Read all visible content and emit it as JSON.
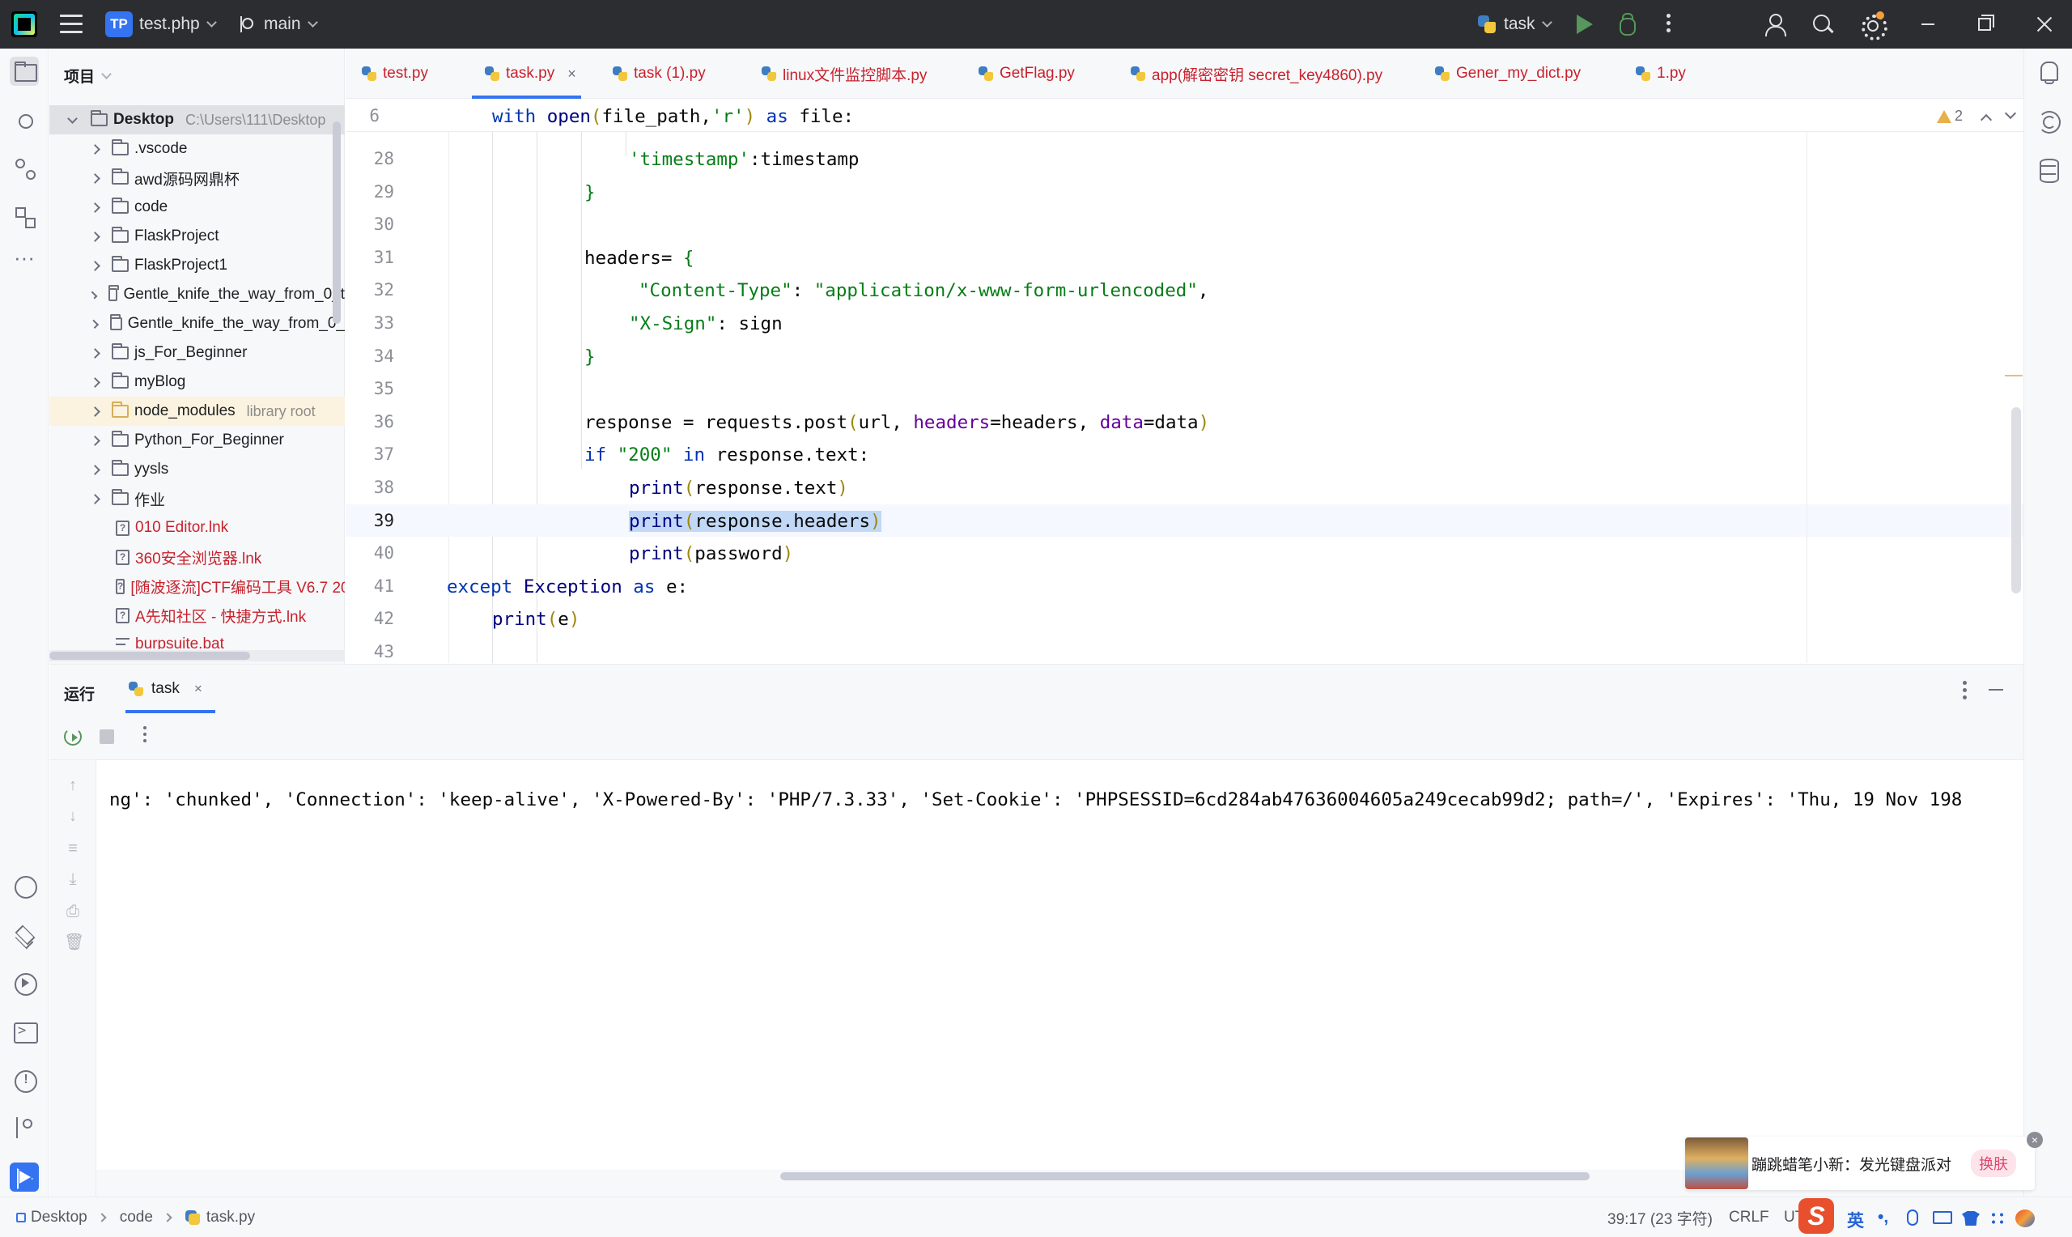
{
  "titlebar": {
    "project_badge": "TP",
    "project_name": "test.php",
    "branch": "main",
    "run_config": "task"
  },
  "left_toolbar": [
    "project",
    "commit",
    "pull-requests",
    "structure",
    "more",
    "python-console",
    "python-packages",
    "services",
    "terminal",
    "problems",
    "git",
    "run"
  ],
  "project_panel": {
    "title": "项目",
    "tree": [
      {
        "name": "Desktop",
        "extra": "C:\\Users\\111\\Desktop",
        "type": "folder",
        "open": true
      },
      {
        "name": ".vscode",
        "type": "folder"
      },
      {
        "name": "awd源码网鼎杯",
        "type": "folder"
      },
      {
        "name": "code",
        "type": "folder"
      },
      {
        "name": "FlaskProject",
        "type": "folder"
      },
      {
        "name": "FlaskProject1",
        "type": "folder"
      },
      {
        "name": "Gentle_knife_the_way_from_0_t",
        "type": "folder"
      },
      {
        "name": "Gentle_knife_the_way_from_0_",
        "type": "folder"
      },
      {
        "name": "js_For_Beginner",
        "type": "folder"
      },
      {
        "name": "myBlog",
        "type": "folder"
      },
      {
        "name": "node_modules",
        "extra": "library root",
        "type": "folder"
      },
      {
        "name": "Python_For_Beginner",
        "type": "folder"
      },
      {
        "name": "yysls",
        "type": "folder"
      },
      {
        "name": "作业",
        "type": "folder"
      },
      {
        "name": "010 Editor.lnk",
        "type": "file"
      },
      {
        "name": "360安全浏览器.lnk",
        "type": "file"
      },
      {
        "name": "[随波逐流]CTF编码工具 V6.7 20",
        "type": "file"
      },
      {
        "name": "A先知社区 - 快捷方式.lnk",
        "type": "file"
      },
      {
        "name": "burpsuite.bat",
        "type": "file"
      }
    ]
  },
  "editor_tabs": [
    {
      "label": "test.py"
    },
    {
      "label": "task.py",
      "active": true,
      "close": "×"
    },
    {
      "label": "task (1).py"
    },
    {
      "label": "linux文件监控脚本.py"
    },
    {
      "label": "GetFlag.py"
    },
    {
      "label": "app(解密密钥 secret_key4860).py"
    },
    {
      "label": "Gener_my_dict.py"
    },
    {
      "label": "1.py"
    }
  ],
  "editor": {
    "sticky_line": {
      "number": "6",
      "text": "with open(file_path,'r') as file:"
    },
    "warnings": "2",
    "lines": [
      {
        "n": "28",
        "text": "'timestamp':timestamp"
      },
      {
        "n": "29",
        "text": "}"
      },
      {
        "n": "30",
        "text": ""
      },
      {
        "n": "31",
        "text": "headers= {"
      },
      {
        "n": "32",
        "text": "\"Content-Type\": \"application/x-www-form-urlencoded\","
      },
      {
        "n": "33",
        "text": "\"X-Sign\": sign"
      },
      {
        "n": "34",
        "text": "}"
      },
      {
        "n": "35",
        "text": ""
      },
      {
        "n": "36",
        "text": "response = requests.post(url, headers=headers, data=data)"
      },
      {
        "n": "37",
        "text": "if \"200\" in response.text:"
      },
      {
        "n": "38",
        "text": "print(response.text)"
      },
      {
        "n": "39",
        "text": "print(response.headers)"
      },
      {
        "n": "40",
        "text": "print(password)"
      },
      {
        "n": "41",
        "text": "except Exception as e:"
      },
      {
        "n": "42",
        "text": "print(e)"
      },
      {
        "n": "43",
        "text": ""
      }
    ]
  },
  "run_panel": {
    "title": "运行",
    "tab": "task",
    "tab_close": "×",
    "output": "ng': 'chunked', 'Connection': 'keep-alive', 'X-Powered-By': 'PHP/7.3.33', 'Set-Cookie': 'PHPSESSID=6cd284ab47636004605a249cecab99d2; path=/', 'Expires': 'Thu, 19 Nov 198"
  },
  "ime_popup": {
    "text": "蹦跳蜡笔小新：发光键盘派对",
    "button": "换肤",
    "close": "×"
  },
  "statusbar": {
    "breadcrumb": [
      "Desktop",
      "code",
      "task.py"
    ],
    "position": "39:17 (23 字符)",
    "line_sep": "CRLF",
    "encoding": "UT",
    "ime_logo": "S",
    "ime_lang": "英",
    "ime_punct": "•,"
  },
  "colors": {
    "accent": "#3574f0",
    "keyword": "#0033b3",
    "string": "#067d17",
    "run_green": "#57965c",
    "error_red": "#c7222d"
  }
}
